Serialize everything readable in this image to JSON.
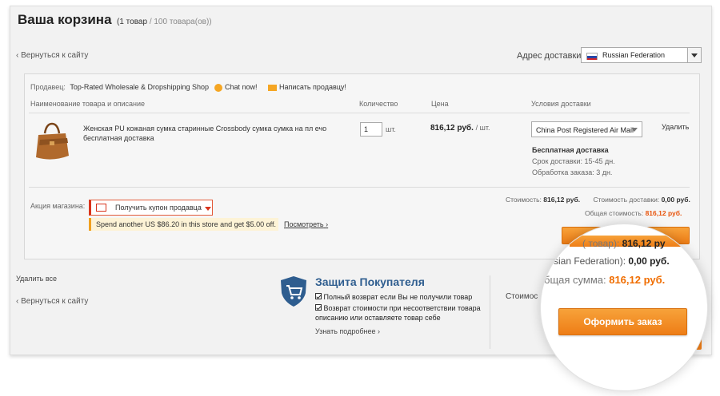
{
  "header": {
    "title": "Ваша корзина",
    "count_text": "1 товар",
    "limit_text": "/ 100 товара(ов))",
    "open_paren": "("
  },
  "back_link": "‹ Вернуться к сайту",
  "shipping_address": {
    "label": "Адрес доставки:",
    "country": "Russian Federation"
  },
  "seller": {
    "label": "Продавец:",
    "name": "Top-Rated Wholesale & Dropshipping Shop",
    "chat": "Chat now!",
    "message": "Написать продавцу!"
  },
  "columns": {
    "product": "Наименование товара и описание",
    "quantity": "Количество",
    "price": "Цена",
    "delivery": "Условия доставки"
  },
  "item": {
    "title": "Женская PU кожаная сумка старинные Crossbody сумка сумка на пл ечо бесплатная доставка",
    "quantity": "1",
    "unit": "шт.",
    "price": "816,12 руб.",
    "per_unit": "/ шт.",
    "shipping_method": "China Post Registered Air Mail",
    "free_shipping": "Бесплатная доставка",
    "delivery_time": "Срок доставки: 15-45 дн.",
    "processing_time": "Обработка заказа: 3 дн.",
    "remove": "Удалить"
  },
  "promo": {
    "label": "Акция магазина:",
    "coupon": "Получить купон продавца",
    "offer": "Spend another US $86.20 in this store and get $5.00 off.",
    "view": "Посмотреть"
  },
  "totals": {
    "cost_label": "Стоимость:",
    "cost_value": "816,12 руб.",
    "shipping_label": "Стоимость доставки:",
    "shipping_value": "0,00 руб.",
    "total_label": "Общая стоимость:",
    "total_value": "816,12 руб."
  },
  "footer": {
    "delete_all": "Удалить все",
    "back": "‹ Вернуться к сайту",
    "partial_cost": "Стоимос"
  },
  "protection": {
    "title": "Защита Покупателя",
    "point1": "Полный возврат если Вы не получили товар",
    "point2": "Возврат стоимости при несоответствии товара описанию или оставляете товар себе",
    "learn_more": "Узнать подробнее"
  },
  "zoom": {
    "items_label": "( товар):",
    "items_value": "816,12 ру",
    "shipping_label": "ssian Federation):",
    "shipping_value": "0,00 руб.",
    "total_label": "бщая сумма:",
    "total_value": "816,12 руб.",
    "checkout": "Оформить заказ"
  },
  "colors": {
    "accent": "#f06d00",
    "button": "#ee7d16",
    "protection_blue": "#2e5d8f"
  }
}
